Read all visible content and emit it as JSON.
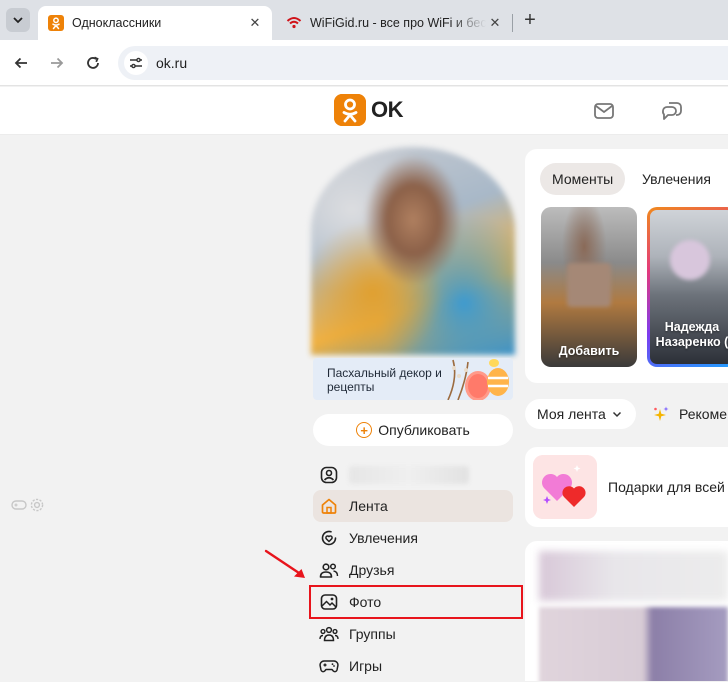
{
  "browser": {
    "tabs": [
      {
        "title": "Одноклассники",
        "active": true,
        "favicon": "ok-favicon"
      },
      {
        "title": "WiFiGid.ru - все про WiFi и бес",
        "active": false,
        "favicon": "wifi-favicon"
      }
    ],
    "url": "ok.ru"
  },
  "header": {
    "logo_text": "OK",
    "brand_color": "#ee8208"
  },
  "profile": {
    "promo_text": "Пасхальный декор и рецепты",
    "publish_label": "Опубликовать"
  },
  "menu": {
    "items": [
      {
        "label": "",
        "icon": "profile-icon"
      },
      {
        "label": "Лента",
        "icon": "home-icon",
        "active": true
      },
      {
        "label": "Увлечения",
        "icon": "heart-circle-icon"
      },
      {
        "label": "Друзья",
        "icon": "friends-icon"
      },
      {
        "label": "Фото",
        "icon": "photo-icon",
        "highlighted": true
      },
      {
        "label": "Группы",
        "icon": "groups-icon"
      },
      {
        "label": "Игры",
        "icon": "gamepad-icon"
      }
    ]
  },
  "moments": {
    "chips": [
      "Моменты",
      "Увлечения"
    ],
    "stories": [
      {
        "caption": "Добавить"
      },
      {
        "caption": "Надежда Назаренко ("
      }
    ]
  },
  "feed": {
    "selector_label": "Моя лента",
    "recommend_label": "Рекоме",
    "gifts_text": "Подарки для всей"
  },
  "annotation": {
    "highlight_color": "#e8141c"
  }
}
